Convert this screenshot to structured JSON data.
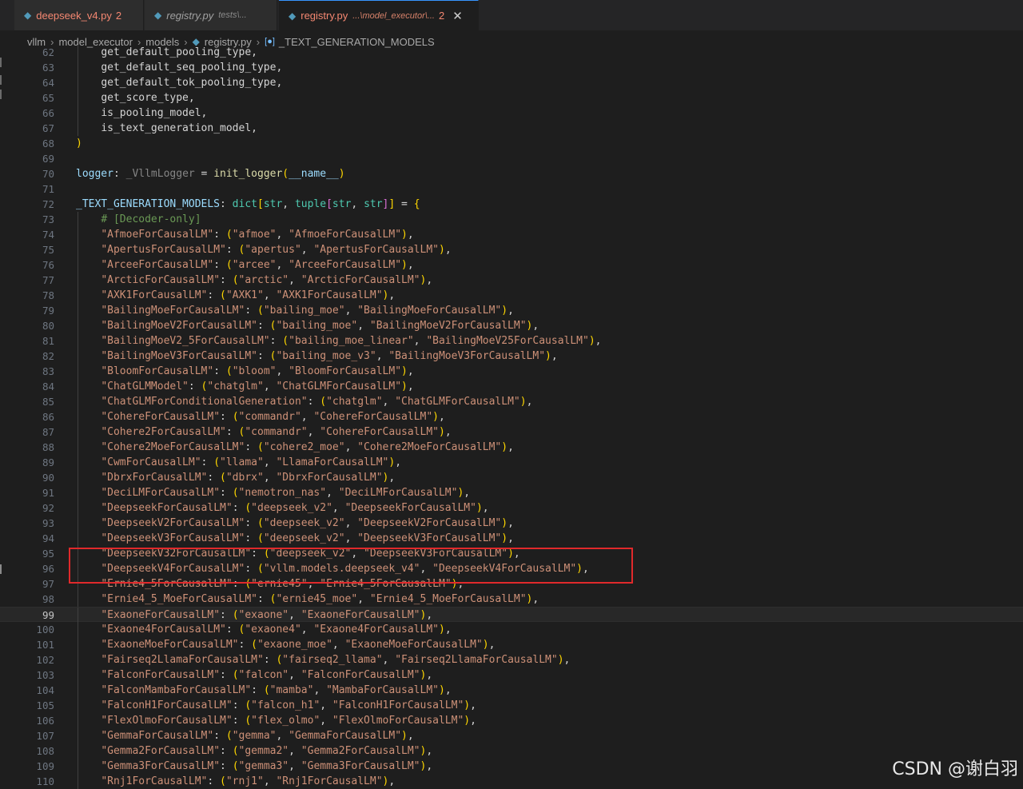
{
  "tabs": [
    {
      "name": "deepseek_v4.py",
      "desc": "",
      "badge": "2",
      "style": "deleted"
    },
    {
      "name": "registry.py",
      "desc": "tests\\...",
      "badge": "",
      "style": "italic"
    },
    {
      "name": "registry.py",
      "desc": "...\\model_executor\\...",
      "badge": "2",
      "style": "active"
    }
  ],
  "breadcrumb": [
    "vllm",
    "model_executor",
    "models",
    "registry.py",
    "_TEXT_GENERATION_MODELS"
  ],
  "editor": {
    "current_line": 99,
    "highlighted_lines": [
      95,
      96
    ],
    "lines": [
      {
        "n": "62",
        "t": "    get_default_pooling_type,"
      },
      {
        "n": "63",
        "t": "    get_default_seq_pooling_type,"
      },
      {
        "n": "64",
        "t": "    get_default_tok_pooling_type,"
      },
      {
        "n": "65",
        "t": "    get_score_type,"
      },
      {
        "n": "66",
        "t": "    is_pooling_model,"
      },
      {
        "n": "67",
        "t": "    is_text_generation_model,"
      },
      {
        "n": "68",
        "t": ")"
      },
      {
        "n": "69",
        "t": ""
      },
      {
        "n": "70",
        "t": "logger: _VllmLogger = init_logger(__name__)"
      },
      {
        "n": "71",
        "t": ""
      },
      {
        "n": "72",
        "t": "_TEXT_GENERATION_MODELS: dict[str, tuple[str, str]] = {"
      },
      {
        "n": "73",
        "t": "    # [Decoder-only]"
      },
      {
        "n": "74",
        "t": "    \"AfmoeForCausalLM\": (\"afmoe\", \"AfmoeForCausalLM\"),"
      },
      {
        "n": "75",
        "t": "    \"ApertusForCausalLM\": (\"apertus\", \"ApertusForCausalLM\"),"
      },
      {
        "n": "76",
        "t": "    \"ArceeForCausalLM\": (\"arcee\", \"ArceeForCausalLM\"),"
      },
      {
        "n": "77",
        "t": "    \"ArcticForCausalLM\": (\"arctic\", \"ArcticForCausalLM\"),"
      },
      {
        "n": "78",
        "t": "    \"AXK1ForCausalLM\": (\"AXK1\", \"AXK1ForCausalLM\"),"
      },
      {
        "n": "79",
        "t": "    \"BailingMoeForCausalLM\": (\"bailing_moe\", \"BailingMoeForCausalLM\"),"
      },
      {
        "n": "80",
        "t": "    \"BailingMoeV2ForCausalLM\": (\"bailing_moe\", \"BailingMoeV2ForCausalLM\"),"
      },
      {
        "n": "81",
        "t": "    \"BailingMoeV2_5ForCausalLM\": (\"bailing_moe_linear\", \"BailingMoeV25ForCausalLM\"),"
      },
      {
        "n": "82",
        "t": "    \"BailingMoeV3ForCausalLM\": (\"bailing_moe_v3\", \"BailingMoeV3ForCausalLM\"),"
      },
      {
        "n": "83",
        "t": "    \"BloomForCausalLM\": (\"bloom\", \"BloomForCausalLM\"),"
      },
      {
        "n": "84",
        "t": "    \"ChatGLMModel\": (\"chatglm\", \"ChatGLMForCausalLM\"),"
      },
      {
        "n": "85",
        "t": "    \"ChatGLMForConditionalGeneration\": (\"chatglm\", \"ChatGLMForCausalLM\"),"
      },
      {
        "n": "86",
        "t": "    \"CohereForCausalLM\": (\"commandr\", \"CohereForCausalLM\"),"
      },
      {
        "n": "87",
        "t": "    \"Cohere2ForCausalLM\": (\"commandr\", \"CohereForCausalLM\"),"
      },
      {
        "n": "88",
        "t": "    \"Cohere2MoeForCausalLM\": (\"cohere2_moe\", \"Cohere2MoeForCausalLM\"),"
      },
      {
        "n": "89",
        "t": "    \"CwmForCausalLM\": (\"llama\", \"LlamaForCausalLM\"),"
      },
      {
        "n": "90",
        "t": "    \"DbrxForCausalLM\": (\"dbrx\", \"DbrxForCausalLM\"),"
      },
      {
        "n": "91",
        "t": "    \"DeciLMForCausalLM\": (\"nemotron_nas\", \"DeciLMForCausalLM\"),"
      },
      {
        "n": "92",
        "t": "    \"DeepseekForCausalLM\": (\"deepseek_v2\", \"DeepseekForCausalLM\"),"
      },
      {
        "n": "93",
        "t": "    \"DeepseekV2ForCausalLM\": (\"deepseek_v2\", \"DeepseekV2ForCausalLM\"),"
      },
      {
        "n": "94",
        "t": "    \"DeepseekV3ForCausalLM\": (\"deepseek_v2\", \"DeepseekV3ForCausalLM\"),"
      },
      {
        "n": "95",
        "t": "    \"DeepseekV32ForCausalLM\": (\"deepseek_v2\", \"DeepseekV3ForCausalLM\"),"
      },
      {
        "n": "96",
        "t": "    \"DeepseekV4ForCausalLM\": (\"vllm.models.deepseek_v4\", \"DeepseekV4ForCausalLM\"),"
      },
      {
        "n": "97",
        "t": "    \"Ernie4_5ForCausalLM\": (\"ernie45\", \"Ernie4_5ForCausalLM\"),"
      },
      {
        "n": "98",
        "t": "    \"Ernie4_5_MoeForCausalLM\": (\"ernie45_moe\", \"Ernie4_5_MoeForCausalLM\"),"
      },
      {
        "n": "99",
        "t": "    \"ExaoneForCausalLM\": (\"exaone\", \"ExaoneForCausalLM\"),"
      },
      {
        "n": "100",
        "t": "    \"Exaone4ForCausalLM\": (\"exaone4\", \"Exaone4ForCausalLM\"),"
      },
      {
        "n": "101",
        "t": "    \"ExaoneMoeForCausalLM\": (\"exaone_moe\", \"ExaoneMoeForCausalLM\"),"
      },
      {
        "n": "102",
        "t": "    \"Fairseq2LlamaForCausalLM\": (\"fairseq2_llama\", \"Fairseq2LlamaForCausalLM\"),"
      },
      {
        "n": "103",
        "t": "    \"FalconForCausalLM\": (\"falcon\", \"FalconForCausalLM\"),"
      },
      {
        "n": "104",
        "t": "    \"FalconMambaForCausalLM\": (\"mamba\", \"MambaForCausalLM\"),"
      },
      {
        "n": "105",
        "t": "    \"FalconH1ForCausalLM\": (\"falcon_h1\", \"FalconH1ForCausalLM\"),"
      },
      {
        "n": "106",
        "t": "    \"FlexOlmoForCausalLM\": (\"flex_olmo\", \"FlexOlmoForCausalLM\"),"
      },
      {
        "n": "107",
        "t": "    \"GemmaForCausalLM\": (\"gemma\", \"GemmaForCausalLM\"),"
      },
      {
        "n": "108",
        "t": "    \"Gemma2ForCausalLM\": (\"gemma2\", \"Gemma2ForCausalLM\"),"
      },
      {
        "n": "109",
        "t": "    \"Gemma3ForCausalLM\": (\"gemma3\", \"Gemma3ForCausalLM\"),"
      },
      {
        "n": "110",
        "t": "    \"Rnj1ForCausalLM\": (\"rnj1\", \"Rnj1ForCausalLM\"),"
      }
    ]
  },
  "watermark": "CSDN @谢白羽",
  "colors": {
    "string": "#ce9178",
    "highlight_box": "#e0292b",
    "tab_modified": "#d7ba7d",
    "tab_deleted": "#f48771",
    "line_number": "#6e7681"
  }
}
